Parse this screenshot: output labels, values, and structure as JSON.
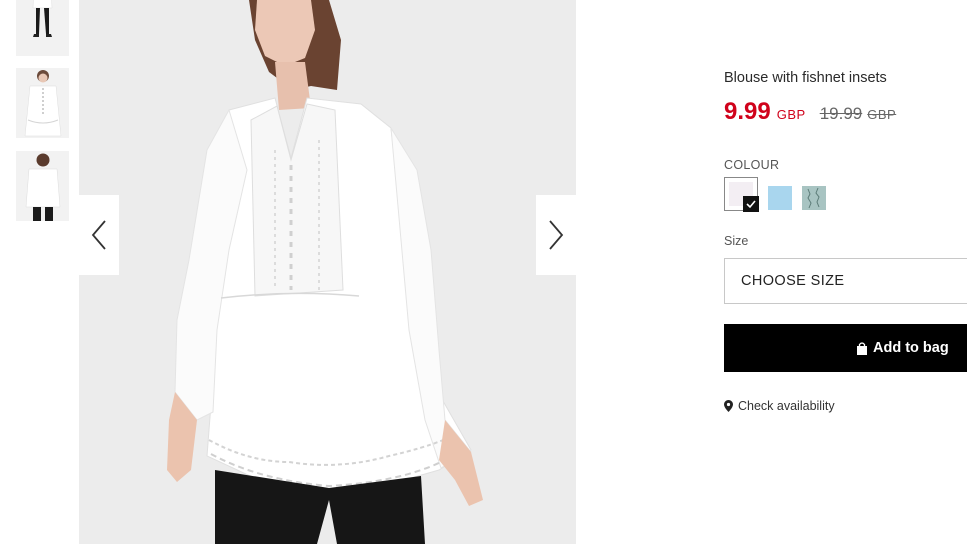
{
  "product": {
    "title": "Blouse with fishnet insets",
    "price_current": "9.99",
    "price_current_currency": "GBP",
    "price_original": "19.99",
    "price_original_currency": "GBP"
  },
  "colour": {
    "label": "COLOUR",
    "swatches": [
      {
        "name": "white",
        "color": "#f3eef3",
        "selected": true
      },
      {
        "name": "light-blue",
        "color": "#a9d6ee",
        "selected": false
      },
      {
        "name": "mint-pattern",
        "color": "#a8c4c2",
        "selected": false
      }
    ]
  },
  "size": {
    "label": "Size",
    "placeholder": "CHOOSE SIZE"
  },
  "actions": {
    "add_to_bag": "Add to bag",
    "check_availability": "Check availability"
  },
  "gallery": {
    "thumbnails": [
      "front-full",
      "front-close",
      "back-view"
    ]
  },
  "colors": {
    "price_red": "#d0021b",
    "button_black": "#000000"
  }
}
